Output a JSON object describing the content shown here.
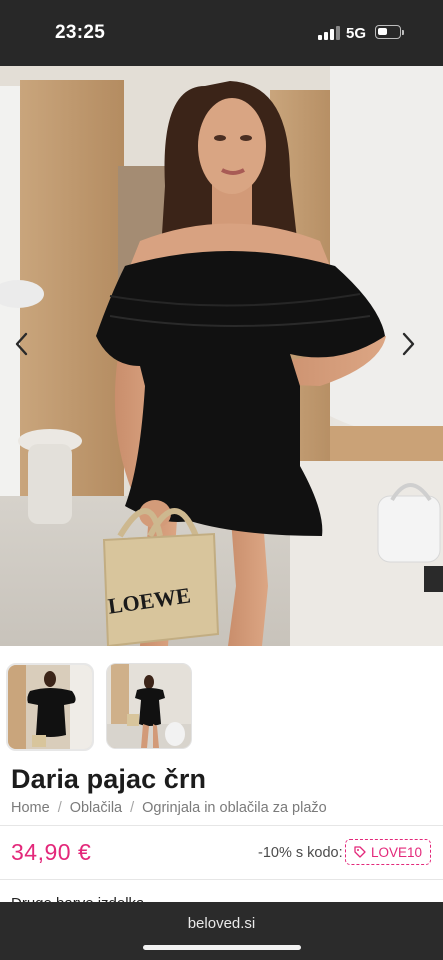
{
  "status_bar": {
    "time": "23:25",
    "network": "5G",
    "battery_level": 0.45,
    "icons": [
      "signal-bars-icon",
      "battery-icon"
    ]
  },
  "gallery": {
    "main_image": "product-photo-woman-black-off-shoulder-romper-with-straw-bag",
    "bag_logo": "LOEWE",
    "prev_icon": "chevron-left-icon",
    "next_icon": "chevron-right-icon",
    "thumbnails_count": 2
  },
  "product": {
    "title": "Daria pajac črn",
    "breadcrumbs": [
      "Home",
      "Oblačila",
      "Ogrinjala in oblačila za plažo"
    ],
    "price": "34,90 €",
    "discount_text": "-10% s kodo:",
    "coupon_code": "LOVE10",
    "coupon_icon": "tag-icon",
    "more_colors_label": "Druge barve izdelka"
  },
  "browser": {
    "url": "beloved.si"
  },
  "colors": {
    "accent": "#e3287a",
    "status_bar_bg": "#282828",
    "browser_bar_bg": "#2b2b2b"
  }
}
